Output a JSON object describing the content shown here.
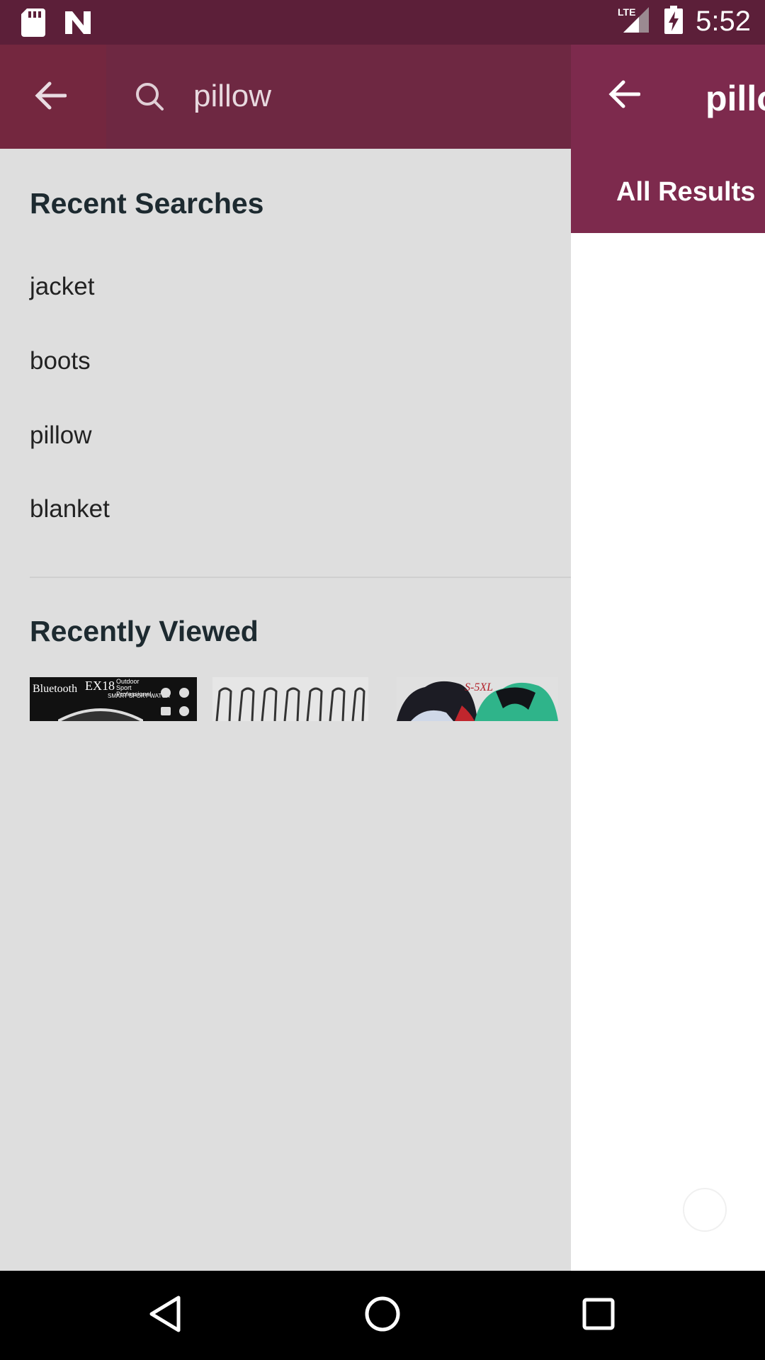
{
  "status_bar": {
    "time": "5:52",
    "network": "LTE",
    "icons": [
      "sd-card-icon",
      "n-logo-icon",
      "signal-icon",
      "battery-charging-icon"
    ]
  },
  "search": {
    "query": "pillow"
  },
  "recent_searches": {
    "title": "Recent Searches",
    "items": [
      "jacket",
      "boots",
      "pillow",
      "blanket"
    ]
  },
  "recently_viewed": {
    "title": "Recently Viewed",
    "items": [
      {
        "brand": "Bluetooth",
        "model": "EX18",
        "tagline": "Outdoor Sport Professional",
        "subtitle": "SMART SPORT WATCH"
      },
      {
        "name": "bobby pins"
      },
      {
        "size_label": "S-5XL"
      }
    ]
  },
  "background_screen": {
    "title": "pillo",
    "tab": "All Results"
  },
  "colors": {
    "status_bar": "#5c1f39",
    "header": "#74273f",
    "drawer_bg": "#dedede",
    "heading_text": "#1d2a30"
  }
}
